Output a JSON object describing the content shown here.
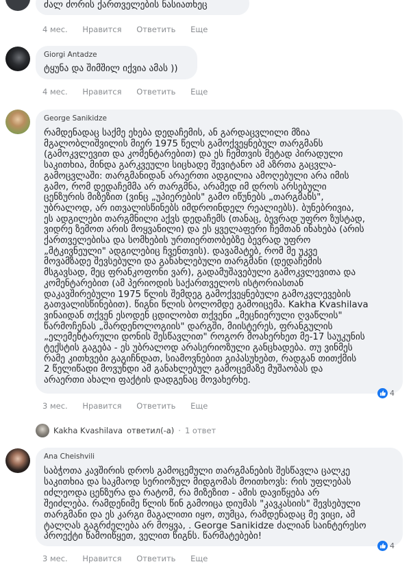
{
  "comments": [
    {
      "author": "",
      "text_lines": [
        "ძალ ძორის ქართველების ნასიათხეც"
      ],
      "actions": {
        "time": "4 мес.",
        "like": "Нравится",
        "reply": "Ответить",
        "more": "Еще"
      }
    },
    {
      "author": "Giorgi Antadze",
      "text_lines": [
        "ტყუნა და შიმშილ იქვია ამას ))"
      ],
      "actions": {
        "time": "4 мес.",
        "like": "Нравится",
        "reply": "Ответить",
        "more": "Еще"
      }
    },
    {
      "author": "George Sanikidze",
      "text_lines": [
        "რამდენადაც საქმე ეხება დედაჩემის, ან გარდაცვლილი მზია",
        "მგალობლიშვილის მიერ 1975 წელს გამოქვეყნებულ თარგმანს",
        "(გამოკვლევით და კომენტარებით) და ეს ჩემთვის მეტად პირადული",
        "საკითხია, მინდა გარკვეული სიცხადე შევიტანო ამ აზრთა გაცვლა-",
        "გამოცვლაში: თარგმანიდან არაერთი ადგილია ამოღებული არა იმის",
        "გამო, რომ დედაჩემმა არ თარგმნა, არამედ იმ დროს არსებული",
        "ცენზურის მიზეზით (ვინც „უპიერების\" გამო იწუნებს „თარგმანს\",",
        "უბრალოდ, არ ითვალისწინებს იმდროინდელ რეალიებს). ბუნებრივია,",
        "ეს ადგილები თარგმნილი აქვს დედაჩემს (თანაც, ბევრად უფრო ზუსტად,",
        "ვიდრე ზემოთ არის მოყვანილი) და ეს ყველაფერი ჩემთან ინახება (არის",
        "ქართველებისა და სომხების ურთიერთობებზე ბევრად უფრო",
        "„მტკივნეული\" ადგილებიც ჩვენთვის). დავამატებ, რომ მე უკვე",
        "მოვამზადე შევსებული და განახლებული თარგმანი (დედაჩემის",
        "მსგავსად, მეც ფრანკოფონი ვარ), გადამუშავებული გამოკვლევითა და",
        "კომენტარებით (ამ პერიოდის საქართველოს ისტორიასთან",
        "დაკავშირებული 1975 წლის შემდეგ გამოქვეყნებული გამოკვლევების",
        "გათვალისწინებით). წიგნი წლის ბოლომდე გამოიცემა. Kakha Kvashilava",
        "ვინაიდან თქვენ ესოდენ ცდილობთ თქვენი „მეცნიერული ღვაწლის\"",
        "წარმოჩენას „შარდენოლოგიის\" დარგში, მიისტერეს, ფრანგულის",
        "„ელემენტარული დონის შესწავლით\" როგორ მოახერხეთ მე-17 საუკუნის",
        "ტექსტის გაგება - ეს უბრალოდ არასერიოზული განცხადება. თუ ვინმეს",
        "რამე კითხვები გაგიჩნდათ, სიამოვნებით გიპასუხებთ, რადგან თითქმის",
        "2 წელიწადი მოვუნდი ამ განახლებულ გამოცემაზე მუშაობას და",
        "არაერთი ახალი ფაქტის დადგენაც მოვახერხე."
      ],
      "reactions": "4",
      "actions": {
        "time": "3 мес.",
        "like": "Нравится",
        "reply": "Ответить",
        "more": "Еще"
      }
    },
    {
      "author": "Ana Cheishvili",
      "text_lines": [
        "საბჭოთა კავშირის დროს გამოცემული თარგმანების შესწავლა ცალკე",
        "საკითხია და საკმაოდ სერიოზულ მიდგომას მოითხოვს: რის უფლებას",
        "იძლეოდა ცენზურა და რატომ, რა მიზეზით - ამის დავიწყება არ",
        "შეიძლება. რამდენიმე წლის წინ გამოიცა დიუმას \"კავკასიის\" შევსებული",
        "თარგმანი და ეს კარგი მაგალითი იყო, თუმცა, რამდენადაც მე ვიცი, ამ",
        "ტალღას გაგრძელება არ მოყვა, . George Sanikidze ძალიან საინტერესო",
        "პროექტი წამოიწყეთ, ველით წიგნს. წარმატებები!"
      ],
      "reactions": "4",
      "actions": {
        "time": "3 мес.",
        "like": "Нравится",
        "reply": "Ответить",
        "more": "Еще"
      }
    }
  ],
  "reply_summary": {
    "author": "Kakha Kvashilava",
    "verb": "ответил(-а)",
    "separator": "·",
    "count": "1 ответ"
  },
  "colors": {
    "bubble": "#f0f2f5",
    "meta_text": "#8a8d91",
    "like_blue": "#1877f2"
  },
  "icons": [
    "avatar",
    "like-icon"
  ]
}
